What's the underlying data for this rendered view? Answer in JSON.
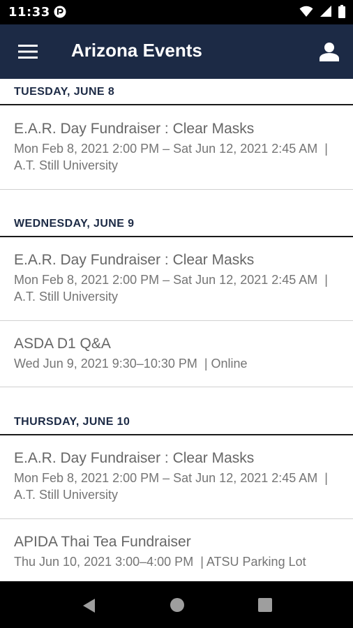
{
  "status_bar": {
    "time": "11:33",
    "icons": [
      "app-notification-icon",
      "wifi-icon",
      "signal-icon",
      "battery-icon"
    ]
  },
  "app_bar": {
    "title": "Arizona Events",
    "menu_icon": "hamburger-menu-icon",
    "account_icon": "account-icon",
    "background": "#1c2a45"
  },
  "days": [
    {
      "header": "TUESDAY, JUNE 8",
      "events": [
        {
          "title": "E.A.R. Day Fundraiser : Clear Masks",
          "meta": "Mon Feb 8, 2021 2:00 PM – Sat Jun 12, 2021 2:45 AM  | A.T. Still University"
        }
      ]
    },
    {
      "header": "WEDNESDAY, JUNE 9",
      "events": [
        {
          "title": "E.A.R. Day Fundraiser : Clear Masks",
          "meta": "Mon Feb 8, 2021 2:00 PM – Sat Jun 12, 2021 2:45 AM  | A.T. Still University"
        },
        {
          "title": "ASDA D1 Q&A",
          "meta": "Wed Jun 9, 2021 9:30–10:30 PM  | Online"
        }
      ]
    },
    {
      "header": "THURSDAY, JUNE 10",
      "events": [
        {
          "title": "E.A.R. Day Fundraiser : Clear Masks",
          "meta": "Mon Feb 8, 2021 2:00 PM – Sat Jun 12, 2021 2:45 AM  | A.T. Still University"
        },
        {
          "title": "APIDA Thai Tea Fundraiser",
          "meta": "Thu Jun 10, 2021 3:00–4:00 PM  | ATSU Parking Lot"
        }
      ]
    }
  ],
  "nav_bar": {
    "icons": [
      "back-icon",
      "home-icon",
      "recents-icon"
    ]
  }
}
